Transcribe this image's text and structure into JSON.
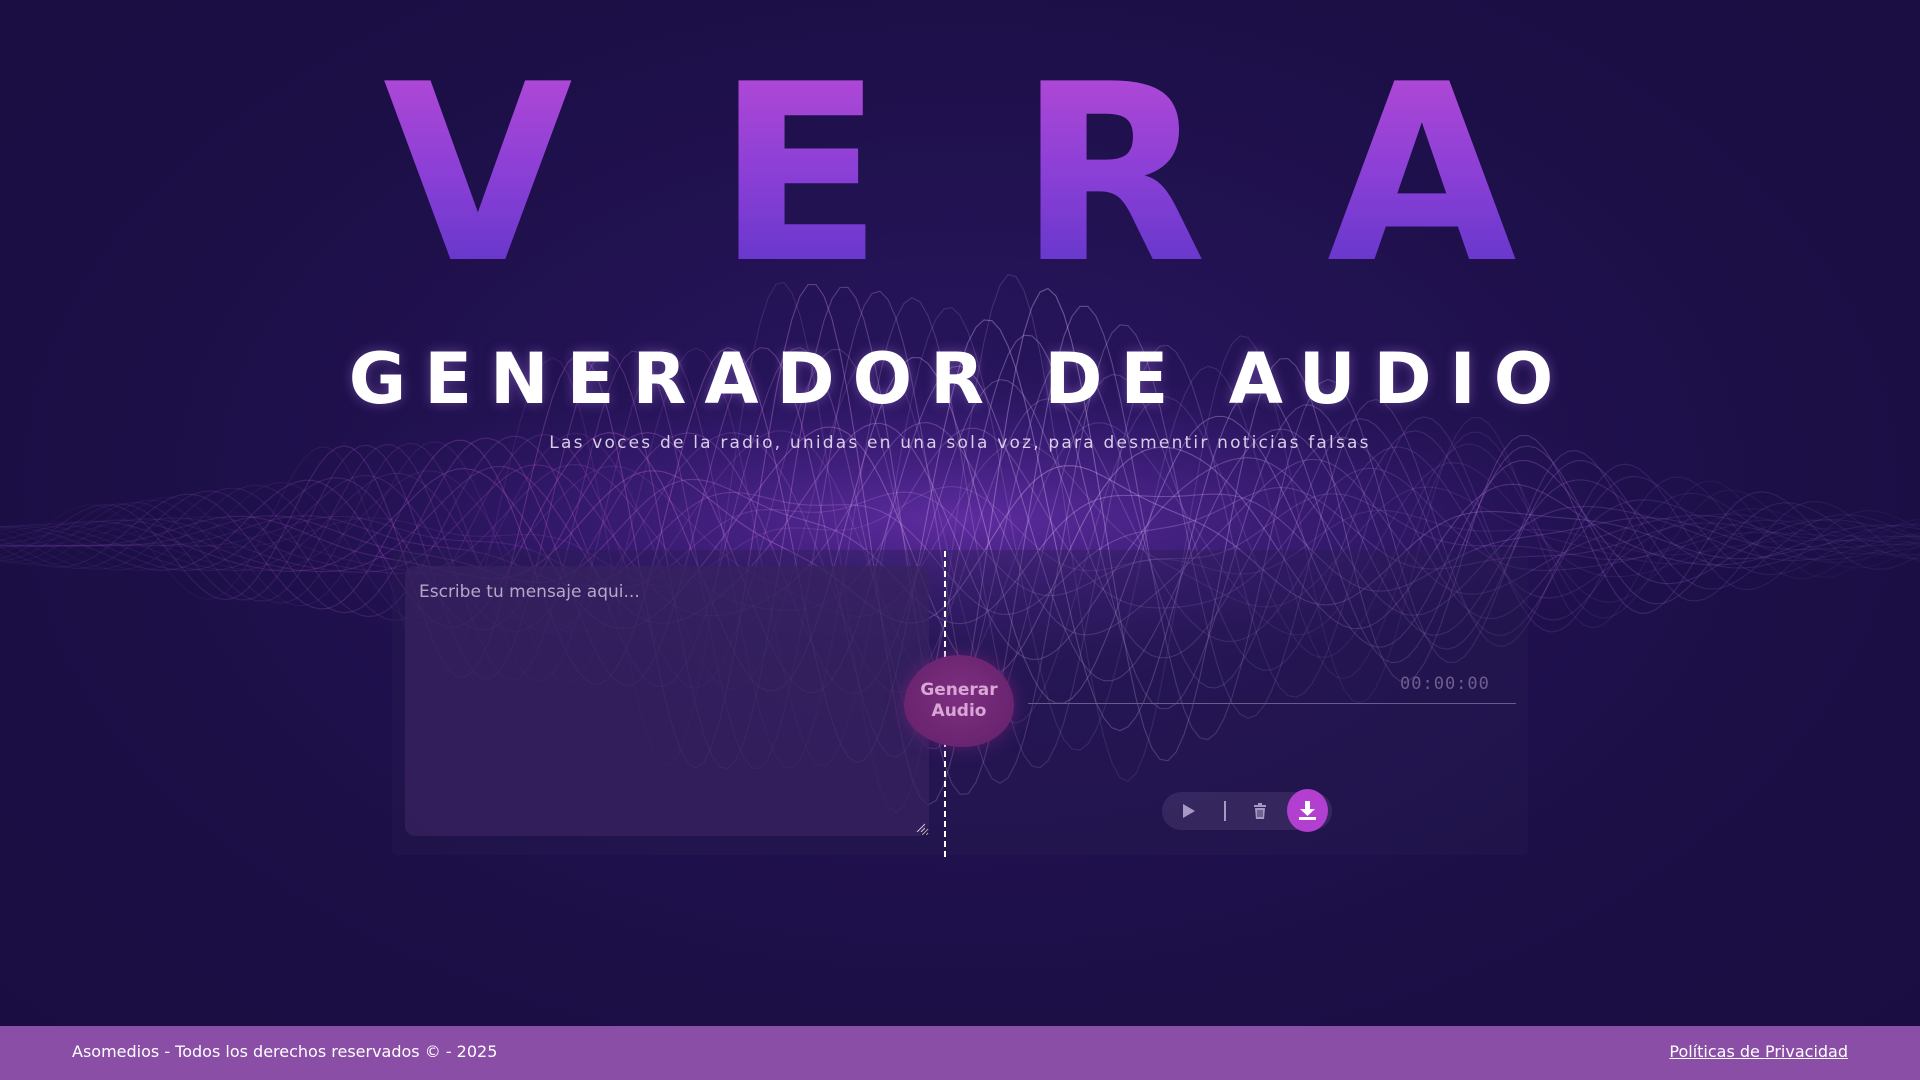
{
  "brand": {
    "letters": [
      "V",
      "E",
      "R",
      "A"
    ]
  },
  "header": {
    "heading": "GENERADOR DE AUDIO",
    "subtitle": "Las voces de la radio, unidas en una sola voz, para desmentir noticias falsas"
  },
  "composer": {
    "placeholder": "Escribe tu mensaje aqui..."
  },
  "generate_button": {
    "line1": "Generar",
    "line2": "Audio"
  },
  "player": {
    "time": "00:00:00",
    "play_icon": "play-icon",
    "delete_icon": "trash-icon",
    "download_icon": "download-icon"
  },
  "footer": {
    "copyright": "Asomedios - Todos los derechos reservados © - 2025",
    "privacy": "Políticas de Privacidad"
  },
  "colors": {
    "background": "#1c0f47",
    "accent": "#b23fcf",
    "footer": "#8a4ea6",
    "title_gradient_top": "#b84ad6",
    "title_gradient_bottom": "#5a34c8"
  }
}
